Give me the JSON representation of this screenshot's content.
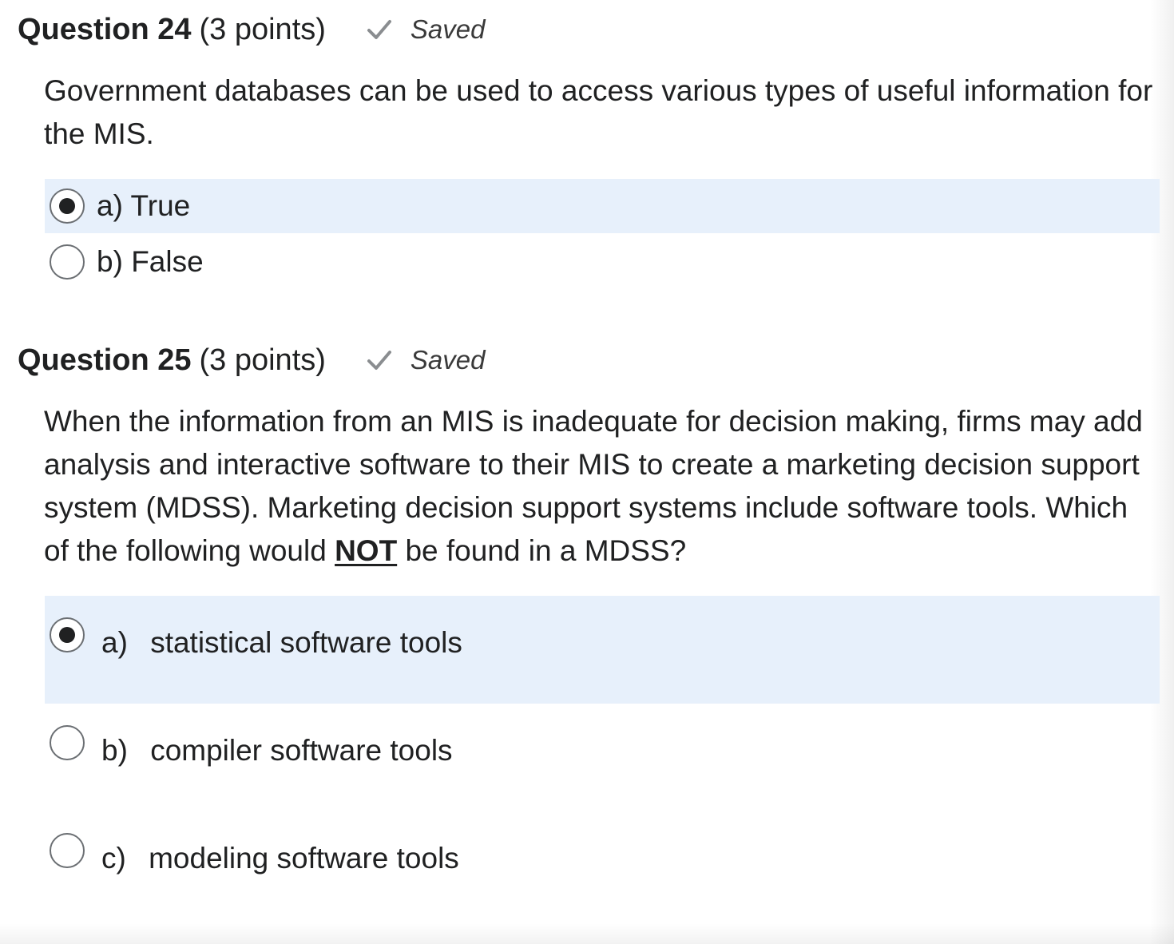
{
  "questions": [
    {
      "title": "Question 24",
      "points": "(3 points)",
      "status": "Saved",
      "status_icon": "check-icon",
      "text": "Government databases can be used to access various types of useful information for the MIS.",
      "options": [
        {
          "letter": "a)",
          "text": "True",
          "selected": true
        },
        {
          "letter": "b)",
          "text": "False",
          "selected": false
        }
      ]
    },
    {
      "title": "Question 25",
      "points": "(3 points)",
      "status": "Saved",
      "status_icon": "check-icon",
      "text_before": "When the information from an MIS is inadequate for decision making, firms may add analysis and interactive software to their MIS to create a marketing decision support system (MDSS). Marketing decision support systems include software tools. Which of the following would ",
      "text_emphasis": "NOT",
      "text_after": " be found in a MDSS?",
      "options": [
        {
          "letter": "a)",
          "text": "statistical software tools",
          "selected": true
        },
        {
          "letter": "b)",
          "text": "compiler software tools",
          "selected": false
        },
        {
          "letter": "c)",
          "text": "modeling software tools",
          "selected": false
        }
      ]
    }
  ],
  "colors": {
    "selected_background": "#e7f0fb",
    "text": "#202122",
    "check": "#8a8d90"
  }
}
